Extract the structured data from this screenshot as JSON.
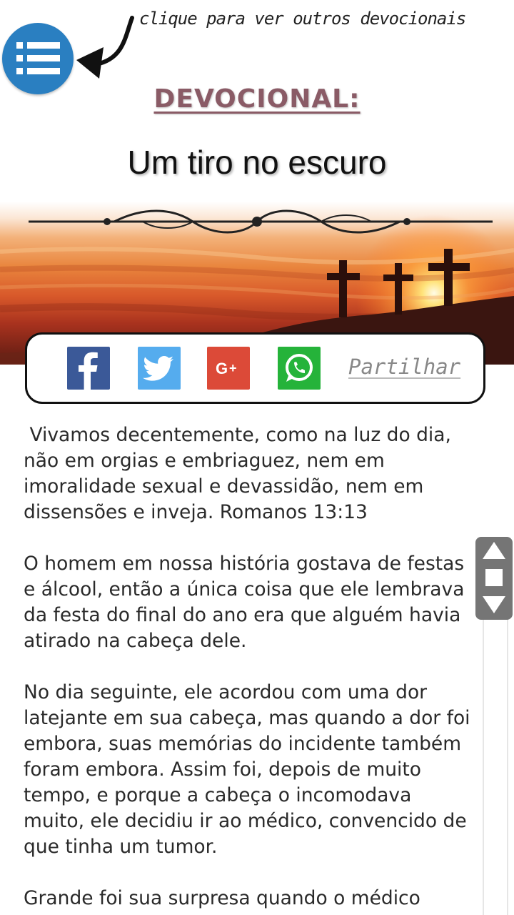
{
  "header": {
    "hint_text": "clique para ver outros devocionais",
    "label": "DEVOCIONAL:",
    "title": "Um tiro no escuro"
  },
  "icons": {
    "menu": "list-menu-icon",
    "hint_arrow": "curved-arrow-icon",
    "facebook": "facebook-icon",
    "twitter": "twitter-icon",
    "googleplus": "google-plus-icon",
    "whatsapp": "whatsapp-icon",
    "scroll_up": "triangle-up-icon",
    "scroll_middle": "square-icon",
    "scroll_down": "triangle-down-icon"
  },
  "share": {
    "label": "Partilhar"
  },
  "content": {
    "paragraphs": [
      " Vivamos decentemente, como na luz do dia, não em orgias e embriaguez, nem em imoralidade sexual e devassidão, nem em dissensões e inveja. Romanos 13:13",
      "O homem em nossa história gostava de festas e álcool, então a única coisa que ele lembrava da festa do final do ano era que alguém havia atirado na cabeça dele.",
      "No dia seguinte, ele acordou com uma dor latejante em sua cabeça, mas quando a dor foi embora, suas memórias do incidente também foram embora. Assim foi, depois de muito tempo, e porque a cabeça o incomodava muito, ele decidiu ir ao médico, convencido de que tinha um tumor.",
      "Grande foi sua surpresa quando o médico"
    ]
  },
  "colors": {
    "menu_button": "#2a7fc1",
    "label": "#8a5b66",
    "facebook": "#3b5998",
    "twitter": "#55acee",
    "googleplus": "#dc4a38",
    "whatsapp": "#25b33a",
    "scroll_widget": "#757575"
  }
}
